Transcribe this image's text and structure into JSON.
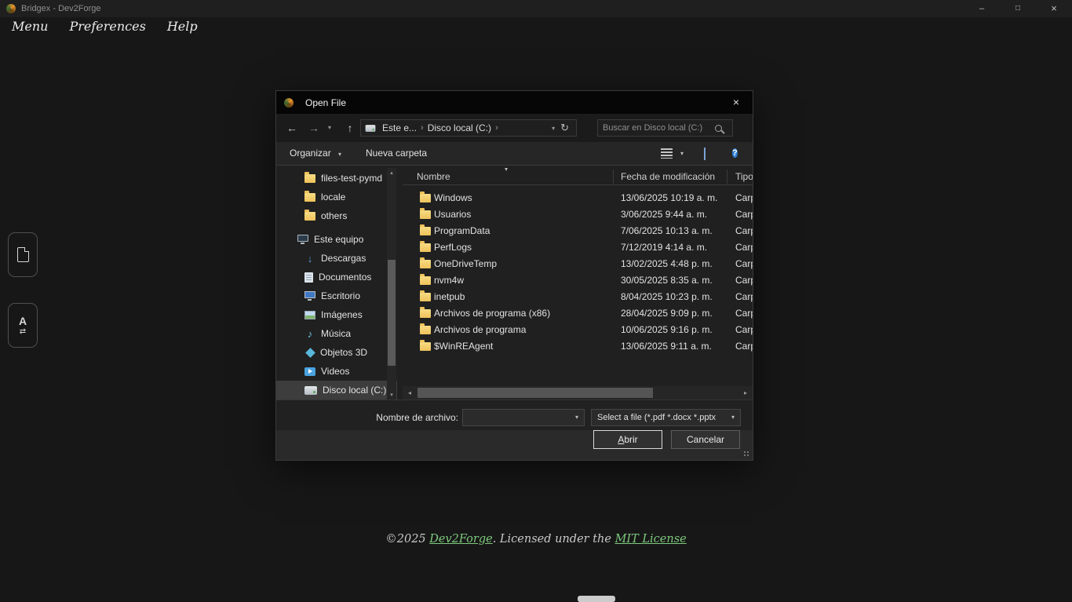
{
  "colors": {
    "accent_green": "#7ec97e",
    "folder_yellow": "#eec25a",
    "help_blue": "#2f7fd6",
    "selection_gray": "#3d3d3d"
  },
  "icons": {
    "minimize": "–",
    "maximize": "□",
    "close": "×",
    "back": "←",
    "forward": "→",
    "up": "↑",
    "refresh": "↻",
    "down_small": "▾",
    "crumb_sep": "›",
    "sort": "▾",
    "scroll_up": "▴",
    "scroll_down": "▾",
    "scroll_left": "◂",
    "scroll_right": "▸",
    "help": "?",
    "download_arrow": "↓",
    "music_note": "♪",
    "translate_a": "A",
    "translate_swap": "⇄"
  },
  "window": {
    "title": "Bridgex - Dev2Forge",
    "menu_items": [
      "Menu",
      "Preferences",
      "Help"
    ]
  },
  "side_buttons": [
    {
      "icon": "new-document"
    },
    {
      "icon": "translate"
    }
  ],
  "dialog": {
    "title": "Open File",
    "nav": {
      "crumbs": [
        "Este e...",
        "Disco local (C:)"
      ],
      "search_placeholder": "Buscar en Disco local (C:)"
    },
    "toolbar": {
      "organize_label": "Organizar",
      "new_folder_label": "Nueva carpeta"
    },
    "sidebar": {
      "items": [
        {
          "label": "files-test-pymd",
          "icon": "folder"
        },
        {
          "label": "locale",
          "icon": "folder"
        },
        {
          "label": "others",
          "icon": "folder"
        },
        {
          "label": "Este equipo",
          "icon": "computer"
        },
        {
          "label": "Descargas",
          "icon": "downloads"
        },
        {
          "label": "Documentos",
          "icon": "documents"
        },
        {
          "label": "Escritorio",
          "icon": "desktop"
        },
        {
          "label": "Imágenes",
          "icon": "pictures"
        },
        {
          "label": "Música",
          "icon": "music"
        },
        {
          "label": "Objetos 3D",
          "icon": "objects-3d"
        },
        {
          "label": "Videos",
          "icon": "videos"
        },
        {
          "label": "Disco local (C:)",
          "icon": "drive",
          "selected": true
        }
      ]
    },
    "list": {
      "columns": [
        "Nombre",
        "Fecha de modificación",
        "Tipo"
      ],
      "rows": [
        {
          "name": "Windows",
          "date": "13/06/2025 10:19 a. m.",
          "type": "Carp"
        },
        {
          "name": "Usuarios",
          "date": "3/06/2025 9:44 a. m.",
          "type": "Carp"
        },
        {
          "name": "ProgramData",
          "date": "7/06/2025 10:13 a. m.",
          "type": "Carp"
        },
        {
          "name": "PerfLogs",
          "date": "7/12/2019 4:14 a. m.",
          "type": "Carp"
        },
        {
          "name": "OneDriveTemp",
          "date": "13/02/2025 4:48 p. m.",
          "type": "Carp"
        },
        {
          "name": "nvm4w",
          "date": "30/05/2025 8:35 a. m.",
          "type": "Carp"
        },
        {
          "name": "inetpub",
          "date": "8/04/2025 10:23 p. m.",
          "type": "Carp"
        },
        {
          "name": "Archivos de programa (x86)",
          "date": "28/04/2025 9:09 p. m.",
          "type": "Carp"
        },
        {
          "name": "Archivos de programa",
          "date": "10/06/2025 9:16 p. m.",
          "type": "Carp"
        },
        {
          "name": "$WinREAgent",
          "date": "13/06/2025 9:11 a. m.",
          "type": "Carp"
        }
      ]
    },
    "footer": {
      "filename_label": "Nombre de archivo:",
      "filename_value": "",
      "filetype_value": "Select a file (*.pdf *.docx *.pptx",
      "open_initial": "A",
      "open_rest": "brir",
      "cancel_label": "Cancelar"
    }
  },
  "page_footer": {
    "prefix": "©2025 ",
    "brand_link": "Dev2Forge",
    "middle": ". Licensed under the ",
    "license_link": "MIT License"
  }
}
